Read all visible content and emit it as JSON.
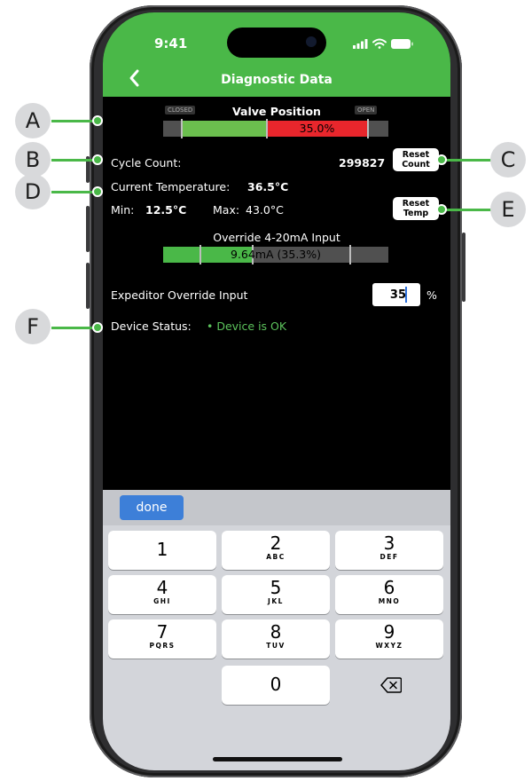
{
  "status_bar": {
    "time": "9:41"
  },
  "header": {
    "title": "Diagnostic Data"
  },
  "valve": {
    "title": "Valve Position",
    "closed_label": "CLOSED",
    "open_label": "OPEN",
    "value_text": "35.0%",
    "position_pct": 35.0
  },
  "cycle": {
    "label": "Cycle Count:",
    "value": "299827",
    "reset_line1": "Reset",
    "reset_line2": "Count"
  },
  "temperature": {
    "label": "Current Temperature:",
    "value": "36.5°C",
    "min_label": "Min:",
    "min_value": "12.5°C",
    "max_label": "Max:",
    "max_value": "43.0°C",
    "reset_line1": "Reset",
    "reset_line2": "Temp"
  },
  "override": {
    "title": "Override 4-20mA Input",
    "value_text": "9.64mA (35.3%)",
    "level_pct": 35.3
  },
  "expeditor": {
    "label": "Expeditor Override Input",
    "value": "35",
    "unit": "%"
  },
  "device_status": {
    "label": "Device Status:",
    "value": "• Device is OK"
  },
  "keyboard": {
    "done_label": "done",
    "keys": [
      {
        "num": "1",
        "letters": ""
      },
      {
        "num": "2",
        "letters": "ABC"
      },
      {
        "num": "3",
        "letters": "DEF"
      },
      {
        "num": "4",
        "letters": "GHI"
      },
      {
        "num": "5",
        "letters": "JKL"
      },
      {
        "num": "6",
        "letters": "MNO"
      },
      {
        "num": "7",
        "letters": "PQRS"
      },
      {
        "num": "8",
        "letters": "TUV"
      },
      {
        "num": "9",
        "letters": "WXYZ"
      },
      {
        "num": "0",
        "letters": ""
      }
    ],
    "delete_icon": "backspace-icon"
  },
  "callouts": [
    "A",
    "B",
    "C",
    "D",
    "E",
    "F"
  ],
  "colors": {
    "accent_green": "#4ab848",
    "valve_green": "#6bbf4e",
    "valve_red": "#e8262c",
    "status_ok": "#5cc35c",
    "done_blue": "#3d7fd8",
    "callout_gray": "#d8d9db"
  }
}
